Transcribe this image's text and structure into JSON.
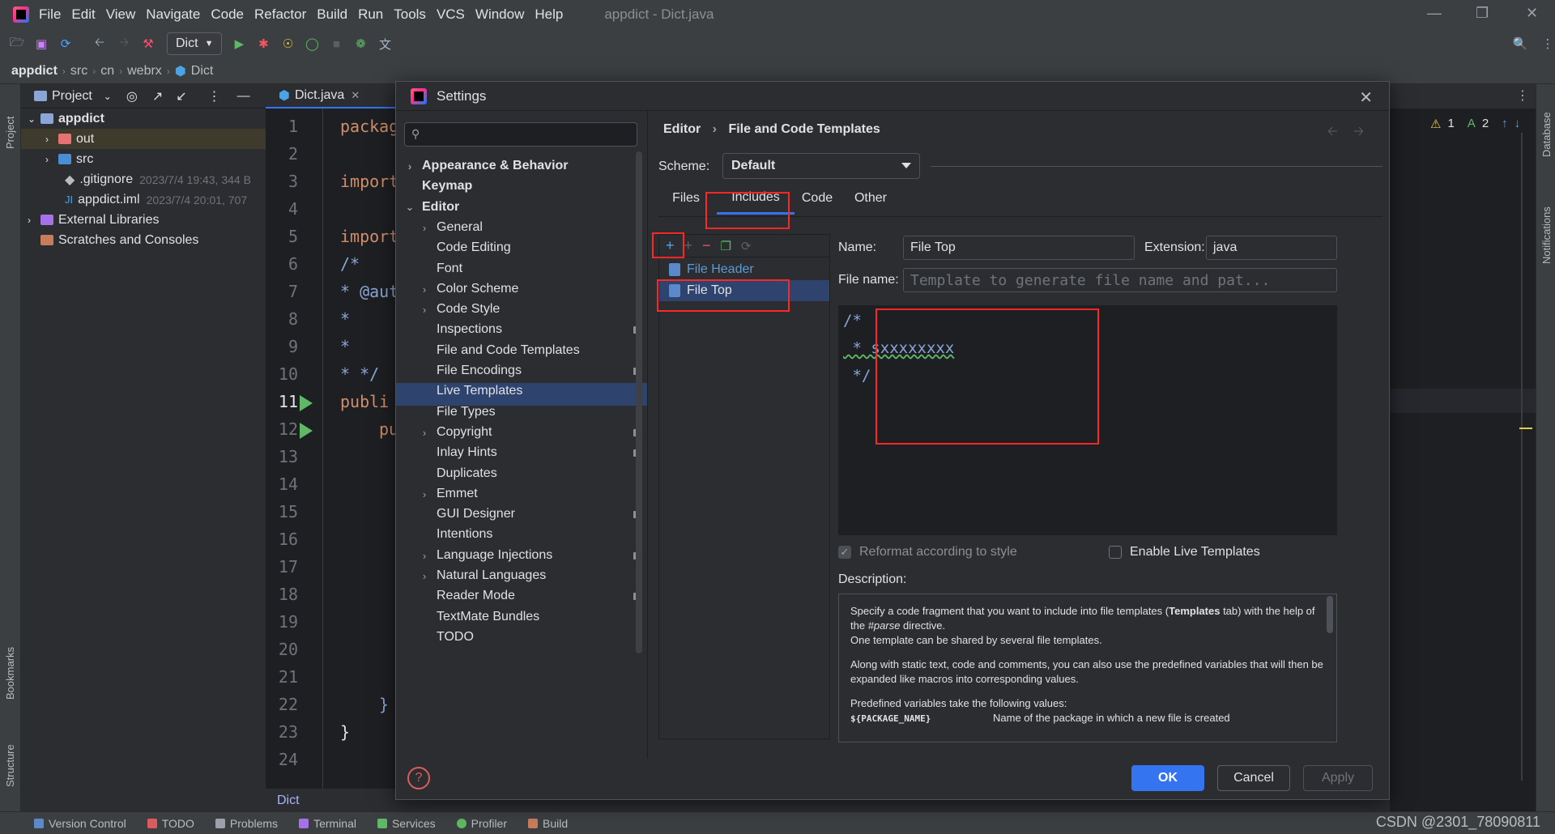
{
  "menubar": {
    "items": [
      "File",
      "Edit",
      "View",
      "Navigate",
      "Code",
      "Refactor",
      "Build",
      "Run",
      "Tools",
      "VCS",
      "Window",
      "Help"
    ],
    "window_title": "appdict - Dict.java"
  },
  "toolbar": {
    "run_config": "Dict"
  },
  "breadcrumb": {
    "items": [
      "appdict",
      "src",
      "cn",
      "webrx",
      "Dict"
    ]
  },
  "left_strip": {
    "project": "Project",
    "bookmarks": "Bookmarks",
    "structure": "Structure"
  },
  "right_strip": {
    "database": "Database",
    "notifications": "Notifications"
  },
  "project_panel": {
    "title": "Project",
    "tree": [
      {
        "label": "appdict",
        "meta": ""
      },
      {
        "label": "out",
        "meta": ""
      },
      {
        "label": "src",
        "meta": ""
      },
      {
        "label": ".gitignore",
        "meta": "2023/7/4 19:43, 344 B"
      },
      {
        "label": "appdict.iml",
        "meta": "2023/7/4 20:01, 707"
      },
      {
        "label": "External Libraries",
        "meta": ""
      },
      {
        "label": "Scratches and Consoles",
        "meta": ""
      }
    ]
  },
  "editor": {
    "tab": "Dict.java",
    "line_numbers": [
      "1",
      "2",
      "3",
      "4",
      "5",
      "6",
      "7",
      "8",
      "9",
      "10",
      "11",
      "12",
      "13",
      "14",
      "15",
      "16",
      "17",
      "18",
      "19",
      "20",
      "21",
      "22",
      "23",
      "24"
    ],
    "code": [
      {
        "line": 1,
        "text": "packag"
      },
      {
        "line": 3,
        "text": "import"
      },
      {
        "line": 5,
        "text": "import"
      },
      {
        "line": 6,
        "text": "/*"
      },
      {
        "line": 7,
        "text": "* @aut"
      },
      {
        "line": 8,
        "text": "*"
      },
      {
        "line": 9,
        "text": "*"
      },
      {
        "line": 10,
        "text": "* */"
      },
      {
        "line": 11,
        "text": "publi"
      },
      {
        "line": 12,
        "text": "pu"
      },
      {
        "line": 22,
        "text": "}"
      },
      {
        "line": 23,
        "text": "}"
      }
    ],
    "footer": "Dict"
  },
  "inspection_widget": {
    "warnings": "1",
    "typos": "2"
  },
  "dialog": {
    "title": "Settings",
    "search_placeholder": "",
    "nav": [
      {
        "label": "Appearance & Behavior",
        "bold": true,
        "chevron": ">",
        "pin": false
      },
      {
        "label": "Keymap",
        "bold": true,
        "chevron": "",
        "pin": false
      },
      {
        "label": "Editor",
        "bold": true,
        "chevron": "v",
        "pin": false
      },
      {
        "label": "General",
        "bold": false,
        "chevron": ">",
        "pin": false
      },
      {
        "label": "Code Editing",
        "bold": false,
        "chevron": "",
        "pin": false
      },
      {
        "label": "Font",
        "bold": false,
        "chevron": "",
        "pin": false
      },
      {
        "label": "Color Scheme",
        "bold": false,
        "chevron": ">",
        "pin": false
      },
      {
        "label": "Code Style",
        "bold": false,
        "chevron": ">",
        "pin": false
      },
      {
        "label": "Inspections",
        "bold": false,
        "chevron": "",
        "pin": true
      },
      {
        "label": "File and Code Templates",
        "bold": false,
        "chevron": "",
        "pin": false
      },
      {
        "label": "File Encodings",
        "bold": false,
        "chevron": "",
        "pin": true
      },
      {
        "label": "Live Templates",
        "bold": false,
        "chevron": "",
        "pin": false
      },
      {
        "label": "File Types",
        "bold": false,
        "chevron": "",
        "pin": false
      },
      {
        "label": "Copyright",
        "bold": false,
        "chevron": ">",
        "pin": true
      },
      {
        "label": "Inlay Hints",
        "bold": false,
        "chevron": "",
        "pin": true
      },
      {
        "label": "Duplicates",
        "bold": false,
        "chevron": "",
        "pin": false
      },
      {
        "label": "Emmet",
        "bold": false,
        "chevron": ">",
        "pin": false
      },
      {
        "label": "GUI Designer",
        "bold": false,
        "chevron": "",
        "pin": true
      },
      {
        "label": "Intentions",
        "bold": false,
        "chevron": "",
        "pin": false
      },
      {
        "label": "Language Injections",
        "bold": false,
        "chevron": ">",
        "pin": true
      },
      {
        "label": "Natural Languages",
        "bold": false,
        "chevron": ">",
        "pin": false
      },
      {
        "label": "Reader Mode",
        "bold": false,
        "chevron": "",
        "pin": true
      },
      {
        "label": "TextMate Bundles",
        "bold": false,
        "chevron": "",
        "pin": false
      },
      {
        "label": "TODO",
        "bold": false,
        "chevron": "",
        "pin": false
      }
    ],
    "header": {
      "parent": "Editor",
      "current": "File and Code Templates"
    },
    "scheme": {
      "label": "Scheme:",
      "value": "Default"
    },
    "tabs": [
      "Files",
      "Includes",
      "Code",
      "Other"
    ],
    "active_tab": "Includes",
    "templates": [
      {
        "label": "File Header",
        "selected": false
      },
      {
        "label": "File Top",
        "selected": true
      }
    ],
    "name": {
      "label": "Name:",
      "value": "File Top"
    },
    "extension": {
      "label": "Extension:",
      "value": "java"
    },
    "file_name": {
      "label": "File name:",
      "placeholder": "Template to generate file name and pat..."
    },
    "template_body": [
      "/*",
      " * sxxxxxxxx",
      " */"
    ],
    "reformat": {
      "label": "Reformat according to style",
      "checked": true,
      "enabled": false
    },
    "live_templates": {
      "label": "Enable Live Templates",
      "checked": false
    },
    "description": {
      "label": "Description:",
      "para1_a": "Specify a code fragment that you want to include into file templates (",
      "para1_bold": "Templates",
      "para1_b": " tab) with the help of the ",
      "para1_em": "#parse",
      "para1_c": " directive.",
      "para1_d": "One template can be shared by several file templates.",
      "para2": "Along with static text, code and comments, you can also use the predefined variables that will then be expanded like macros into corresponding values.",
      "para3": "Predefined variables take the following values:",
      "var_name": "${PACKAGE_NAME}",
      "var_desc": "Name of the package in which a new file is created"
    },
    "buttons": {
      "ok": "OK",
      "cancel": "Cancel",
      "apply": "Apply",
      "help": "?"
    }
  },
  "status_bar": {
    "items": [
      "Version Control",
      "TODO",
      "Problems",
      "Terminal",
      "Services",
      "Profiler",
      "Build"
    ],
    "watermark": "CSDN @2301_78090811"
  },
  "colors": {
    "accent": "#3574f0",
    "annotation": "#ff2626",
    "run": "#5fb865"
  }
}
